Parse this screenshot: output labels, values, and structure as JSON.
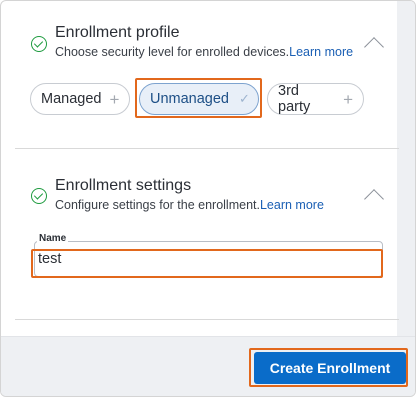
{
  "enrollment_profile": {
    "title": "Enrollment profile",
    "description": "Choose security level for enrolled devices.",
    "learn_more": "Learn more",
    "options": [
      {
        "label": "Managed",
        "selected": false
      },
      {
        "label": "Unmanaged",
        "selected": true
      },
      {
        "label": "3rd party",
        "selected": false
      }
    ]
  },
  "enrollment_settings": {
    "title": "Enrollment settings",
    "description": "Configure settings for the enrollment.",
    "learn_more": "Learn more",
    "name_field": {
      "label": "Name",
      "value": "test"
    }
  },
  "footer": {
    "create_button": "Create Enrollment"
  },
  "icons": {
    "status": "check-circle-icon",
    "collapse": "chevron-up-icon",
    "add": "plus-icon",
    "selected": "checkmark-icon"
  },
  "colors": {
    "accent": "#0a6cc9",
    "success": "#1e9b3f",
    "highlight": "#e2681c",
    "selected_chip_bg": "#e8eff8"
  }
}
